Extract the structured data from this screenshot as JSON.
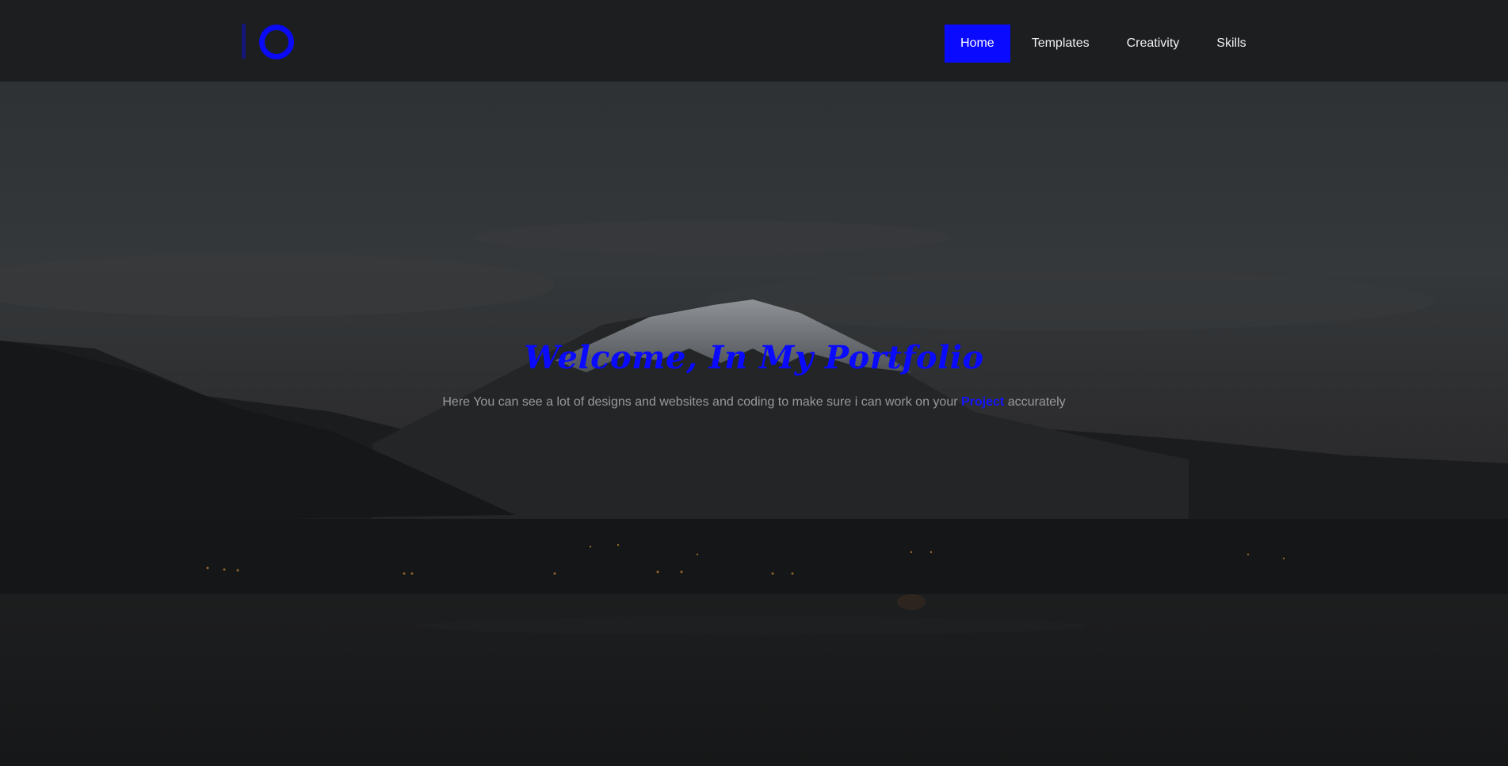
{
  "nav": {
    "items": [
      {
        "label": "Home",
        "active": true
      },
      {
        "label": "Templates",
        "active": false
      },
      {
        "label": "Creativity",
        "active": false
      },
      {
        "label": "Skills",
        "active": false
      }
    ]
  },
  "hero": {
    "title": "Welcome, In My Portfolio",
    "subtitle_before": "Here You can see a lot of designs and websites and coding to make sure i can work on your ",
    "subtitle_highlight": "Project",
    "subtitle_after": " accurately"
  },
  "colors": {
    "accent": "#0a0aff",
    "background": "#151718",
    "navbar": "#1b1d1e"
  },
  "icons": {
    "logo": "logo-bar-ring-icon"
  }
}
